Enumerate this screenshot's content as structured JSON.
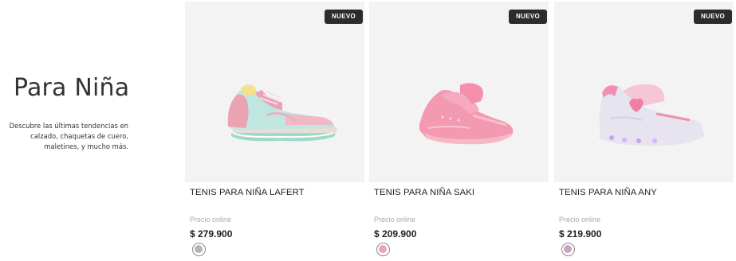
{
  "intro": {
    "title": "Para Niña",
    "description": "Descubre las últimas tendencias en calzado, chaquetas de cuero, maletines, y mucho más."
  },
  "products": [
    {
      "badge": "NUEVO",
      "name": "TENIS PARA NIÑA LAFERT",
      "price_label": "Precio online",
      "price": "$ 279.900",
      "swatch_color": "#b8b2b8",
      "image_icon": "sneaker-mint-pink"
    },
    {
      "badge": "NUEVO",
      "name": "TENIS PARA NIÑA SAKI",
      "price_label": "Precio online",
      "price": "$ 209.900",
      "swatch_color": "#f0a0b8",
      "image_icon": "sneaker-pink"
    },
    {
      "badge": "NUEVO",
      "name": "TENIS PARA NIÑA ANY",
      "price_label": "Precio online",
      "price": "$ 219.900",
      "swatch_color": "#c9a6bf",
      "image_icon": "sneaker-light-up-lilac"
    }
  ]
}
